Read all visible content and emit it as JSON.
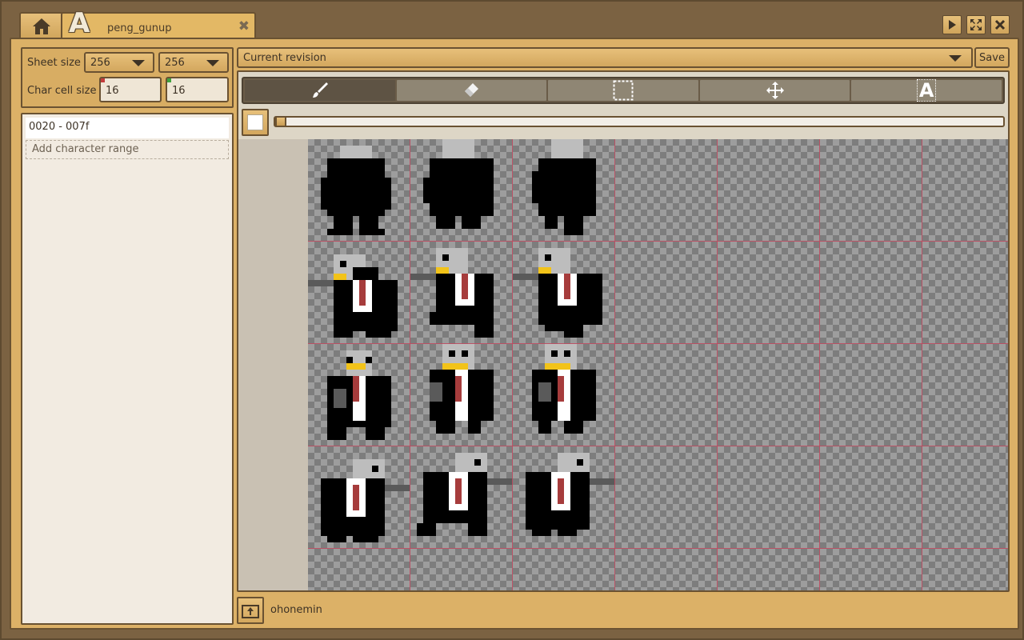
{
  "tab": {
    "logo_letter": "A",
    "title": "peng_gunup",
    "close_glyph": "✖"
  },
  "sheet": {
    "sheet_size_label": "Sheet size",
    "sheet_width": "256",
    "sheet_height": "256",
    "char_cell_label": "Char cell size",
    "cell_width": "16",
    "cell_height": "16"
  },
  "ranges": {
    "items": [
      "0020 - 007f"
    ],
    "add_label": "Add character range"
  },
  "revision": {
    "selected": "Current revision",
    "save_label": "Save"
  },
  "tools": [
    {
      "name": "brush-tool",
      "icon": "brush-icon",
      "active": true
    },
    {
      "name": "eraser-tool",
      "icon": "eraser-icon",
      "active": false
    },
    {
      "name": "select-tool",
      "icon": "selection-icon",
      "active": false
    },
    {
      "name": "move-tool",
      "icon": "move-icon",
      "active": false
    },
    {
      "name": "text-tool",
      "icon": "text-icon",
      "active": false,
      "glyph": "A"
    }
  ],
  "brush": {
    "color": "#ffffff",
    "size_level": 0
  },
  "footer": {
    "author": "ohonemin"
  },
  "colors": {
    "accent": "#e3b865",
    "frame": "#7b6242",
    "grid": "#c2495f"
  }
}
